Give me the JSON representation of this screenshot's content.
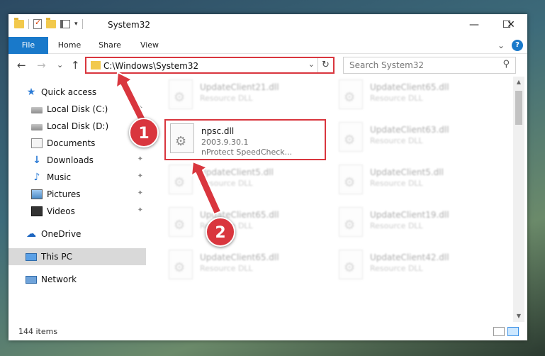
{
  "window": {
    "title": "System32"
  },
  "window_controls": {
    "minimize": "—",
    "maximize": "☐",
    "close": "✕"
  },
  "ribbon": {
    "tabs": [
      {
        "label": "File"
      },
      {
        "label": "Home"
      },
      {
        "label": "Share"
      },
      {
        "label": "View"
      }
    ],
    "expand_icon": "⌄",
    "help_icon": "?"
  },
  "nav": {
    "back": "←",
    "forward": "→",
    "recent": "⌄",
    "up": "↑",
    "address": "C:\\Windows\\System32",
    "address_dropdown": "⌄",
    "refresh": "↻",
    "search_placeholder": "Search System32",
    "search_icon": "⚲"
  },
  "sidebar": {
    "items": [
      {
        "label": "Quick access",
        "icon": "star-icon"
      },
      {
        "label": "Local Disk (C:)",
        "icon": "drive-icon"
      },
      {
        "label": "Local Disk (D:)",
        "icon": "drive-icon"
      },
      {
        "label": "Documents",
        "icon": "documents-icon"
      },
      {
        "label": "Downloads",
        "icon": "download-icon"
      },
      {
        "label": "Music",
        "icon": "music-icon"
      },
      {
        "label": "Pictures",
        "icon": "pictures-icon"
      },
      {
        "label": "Videos",
        "icon": "videos-icon"
      },
      {
        "label": "OneDrive",
        "icon": "cloud-icon"
      },
      {
        "label": "This PC",
        "icon": "computer-icon"
      },
      {
        "label": "Network",
        "icon": "network-icon"
      }
    ],
    "pin_glyph": "✦"
  },
  "files": [
    {
      "name": "UpdateClient21.dll",
      "type": "Resource DLL",
      "version": "",
      "desc": ""
    },
    {
      "name": "UpdateClient65.dll",
      "type": "Resource DLL",
      "version": "",
      "desc": ""
    },
    {
      "name": "npsc.dll",
      "type": "",
      "version": "2003.9.30.1",
      "desc": "nProtect SpeedCheck..."
    },
    {
      "name": "UpdateClient63.dll",
      "type": "Resource DLL",
      "version": "",
      "desc": ""
    },
    {
      "name": "UpdateClient5.dll",
      "type": "Resource DLL",
      "version": "",
      "desc": ""
    },
    {
      "name": "UpdateClient5.dll",
      "type": "Resource DLL",
      "version": "",
      "desc": ""
    },
    {
      "name": "UpdateClient65.dll",
      "type": "Resource DLL",
      "version": "",
      "desc": ""
    },
    {
      "name": "UpdateClient19.dll",
      "type": "Resource DLL",
      "version": "",
      "desc": ""
    },
    {
      "name": "UpdateClient65.dll",
      "type": "Resource DLL",
      "version": "",
      "desc": ""
    },
    {
      "name": "UpdateClient42.dll",
      "type": "Resource DLL",
      "version": "",
      "desc": ""
    }
  ],
  "status": {
    "count": "144 items"
  },
  "callouts": [
    {
      "label": "1"
    },
    {
      "label": "2"
    }
  ],
  "colors": {
    "accent": "#1979ca",
    "highlight": "#d9363e"
  }
}
